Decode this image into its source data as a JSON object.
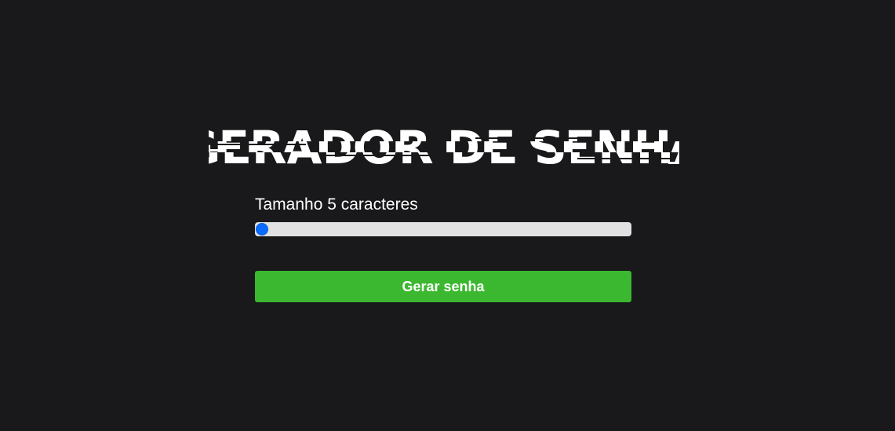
{
  "header": {
    "title": "GERADOR DE SENHA"
  },
  "size": {
    "label": "Tamanho 5 caracteres",
    "value": 5,
    "min": 5,
    "max": 100
  },
  "actions": {
    "generate_label": "Gerar senha"
  },
  "colors": {
    "background": "#19191b",
    "accent_button": "#3bb82f",
    "slider_thumb": "#0a6cff",
    "slider_track": "#e1e1e1",
    "text": "#ffffff"
  }
}
